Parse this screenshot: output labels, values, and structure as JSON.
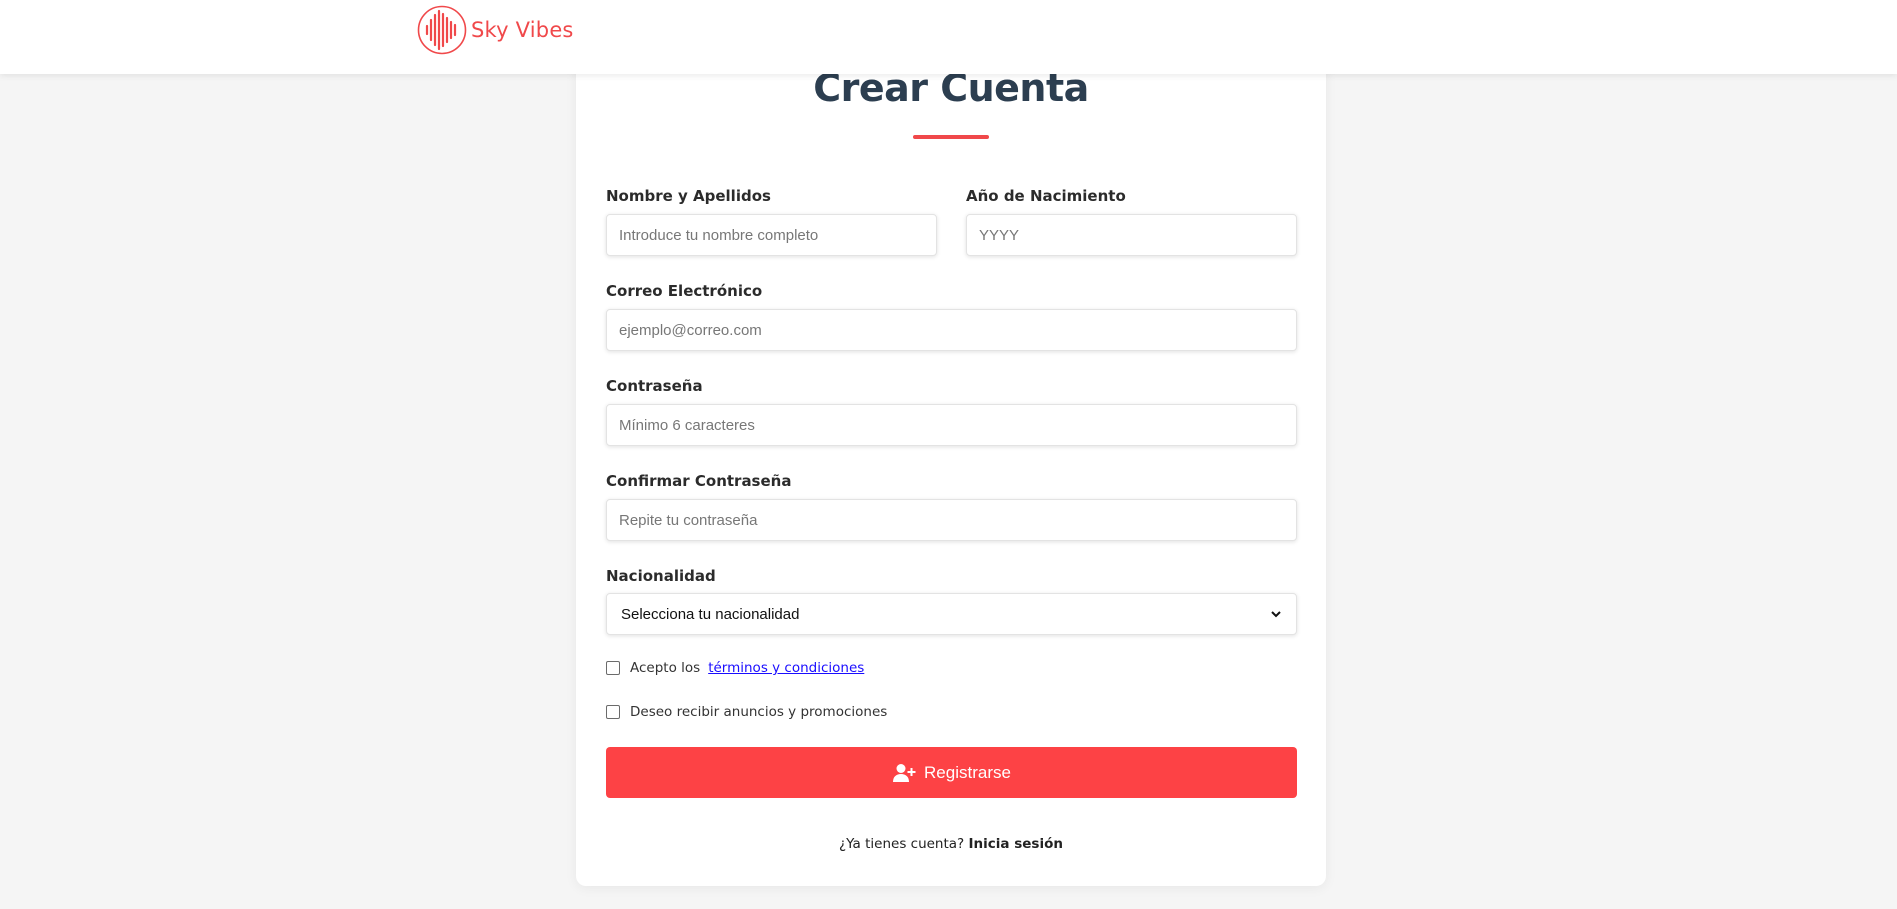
{
  "brand": {
    "name": "Sky Vibes",
    "icon": "soundwave-logo-icon",
    "color": "#f0484a"
  },
  "form": {
    "title": "Crear Cuenta",
    "accent_color": "#f0484a",
    "fields": {
      "name": {
        "label": "Nombre y Apellidos",
        "placeholder": "Introduce tu nombre completo",
        "value": ""
      },
      "birth_year": {
        "label": "Año de Nacimiento",
        "placeholder": "YYYY",
        "value": ""
      },
      "email": {
        "label": "Correo Electrónico",
        "placeholder": "ejemplo@correo.com",
        "value": ""
      },
      "password": {
        "label": "Contraseña",
        "placeholder": "Mínimo 6 caracteres",
        "value": ""
      },
      "confirm_password": {
        "label": "Confirmar Contraseña",
        "placeholder": "Repite tu contraseña",
        "value": ""
      },
      "nationality": {
        "label": "Nacionalidad",
        "selected": "Selecciona tu nacionalidad",
        "icon": "chevron-down-icon"
      }
    },
    "terms": {
      "prefix": "Acepto los",
      "link": "términos y condiciones",
      "checked": false
    },
    "promotions": {
      "label": "Deseo recibir anuncios y promociones",
      "checked": false
    },
    "submit": {
      "label": "Registrarse",
      "icon": "user-plus-icon",
      "color": "#fd4245"
    },
    "footer": {
      "question": "¿Ya tienes cuenta?",
      "login_link": "Inicia sesión"
    }
  }
}
